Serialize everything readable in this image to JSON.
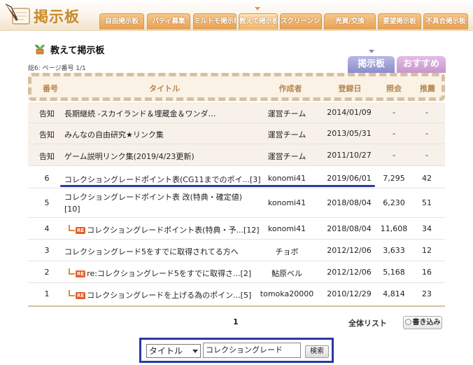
{
  "header": {
    "brand_title": "掲示板",
    "nav_tabs": [
      "自由掲示板",
      "パティ募集",
      "ミルトモ掲示板",
      "教えて掲示板",
      "スクリーンショット",
      "売買/交換",
      "要望掲示板",
      "不具合掲示板"
    ]
  },
  "board": {
    "title": "教えて掲示板",
    "page_info": "総6: ページ番号 1/1",
    "view_tabs": [
      "掲示板",
      "おすすめ"
    ]
  },
  "table": {
    "headers": {
      "num": "番号",
      "title": "タイトル",
      "author": "作成者",
      "date": "登録日",
      "views": "照会",
      "rec": "推薦"
    },
    "notices": [
      {
        "num": "告知",
        "title": "長期継続 -スカイランド＆埋蔵金＆ワンダ…",
        "author": "運営チーム",
        "date": "2014/01/09",
        "views": "-",
        "rec": "-"
      },
      {
        "num": "告知",
        "title": "みんなの自由研究★リンク集",
        "author": "運営チーム",
        "date": "2013/05/31",
        "views": "-",
        "rec": "-"
      },
      {
        "num": "告知",
        "title": "ゲーム説明リンク集(2019/4/23更新)",
        "author": "運営チーム",
        "date": "2011/10/27",
        "views": "-",
        "rec": "-"
      }
    ],
    "posts": [
      {
        "num": "6",
        "title": "コレクショングレードポイント表(CG11までのポイ...[3]",
        "author": "konomi41",
        "date": "2019/06/01",
        "views": "7,295",
        "rec": "42"
      },
      {
        "num": "5",
        "title": "コレクショングレードポイント表 改(特典・確定値)[10]",
        "author": "konomi41",
        "date": "2018/08/04",
        "views": "6,230",
        "rec": "51"
      },
      {
        "num": "4",
        "re": "RE",
        "title": "コレクショングレードポイント表(特典・予...[12]",
        "author": "konomi41",
        "date": "2018/08/04",
        "views": "11,608",
        "rec": "34"
      },
      {
        "num": "3",
        "title": "コレクショングレード5をすでに取得されてる方へ",
        "author": "チョボ",
        "date": "2012/12/06",
        "views": "3,633",
        "rec": "12"
      },
      {
        "num": "2",
        "re": "RE",
        "title": "re:コレクショングレード5をすでに取得さ...[2]",
        "author": "鮎原ベル",
        "date": "2012/12/06",
        "views": "5,168",
        "rec": "16"
      },
      {
        "num": "1",
        "re": "RE",
        "title": "コレクショングレードを上げる為のポイン...[5]",
        "author": "tomoka20000",
        "date": "2010/12/29",
        "views": "4,814",
        "rec": "23"
      }
    ]
  },
  "footer": {
    "page_number": "1",
    "all_list": "全体リスト",
    "write_button": "書き込み"
  },
  "search": {
    "field_selected": "タイトル",
    "query": "コレクショングレード",
    "button": "検索"
  },
  "colors": {
    "accent_orange": "#e7a052",
    "highlight_blue": "#2b38a4"
  }
}
